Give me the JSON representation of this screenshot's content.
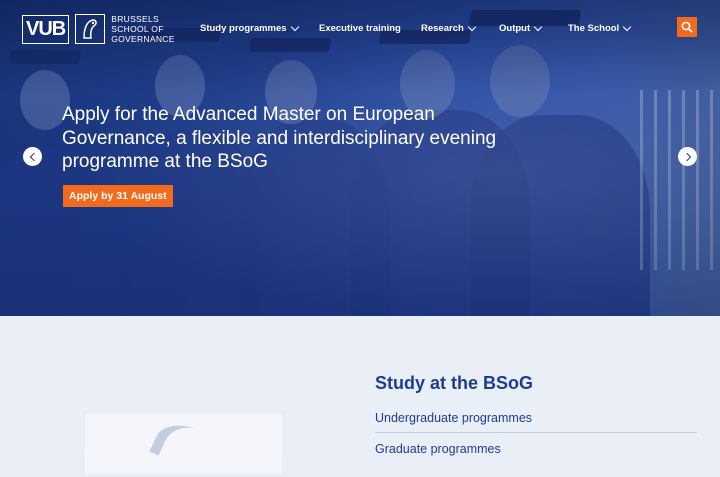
{
  "logo": {
    "vub": "VUB",
    "line1": "BRUSSELS",
    "line2": "SCHOOL OF",
    "line3": "GOVERNANCE"
  },
  "nav": {
    "items": [
      {
        "label": "Study programmes",
        "has_dropdown": true
      },
      {
        "label": "Executive training",
        "has_dropdown": false
      },
      {
        "label": "Research",
        "has_dropdown": true
      },
      {
        "label": "Output",
        "has_dropdown": true
      },
      {
        "label": "The School",
        "has_dropdown": true
      }
    ],
    "search_icon": "search-icon"
  },
  "hero": {
    "headline": "Apply for the Advanced Master on European Governance, a flexible and interdisciplinary evening programme at the BSoG",
    "cta_label": "Apply by 31 August",
    "prev_icon": "chevron-left-icon",
    "next_icon": "chevron-right-icon"
  },
  "study": {
    "title": "Study at the BSoG",
    "links": [
      {
        "label": "Undergraduate programmes"
      },
      {
        "label": "Graduate programmes"
      }
    ]
  },
  "colors": {
    "accent": "#f26a1b",
    "brand_blue": "#1f3d8f",
    "lower_bg": "#e9eef7"
  }
}
